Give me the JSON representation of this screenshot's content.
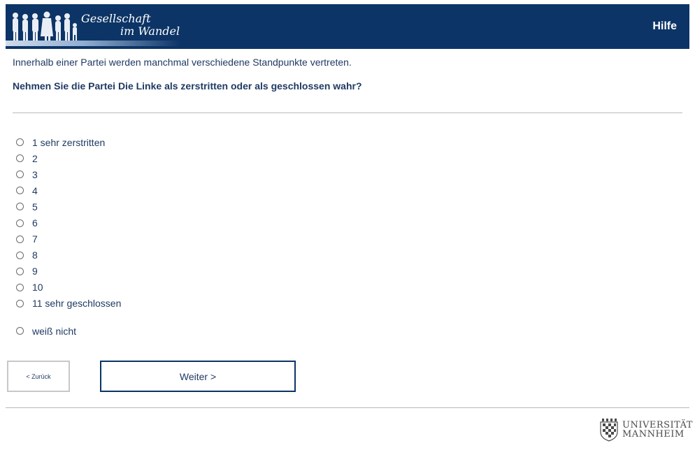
{
  "header": {
    "logo_line1": "Gesellschaft",
    "logo_line2": "im Wandel",
    "help_label": "Hilfe"
  },
  "question": {
    "intro": "Innerhalb einer Partei werden manchmal verschiedene Standpunkte vertreten.",
    "text": "Nehmen Sie die Partei Die Linke als zerstritten oder als geschlossen wahr?"
  },
  "options": [
    "1 sehr zerstritten",
    "2",
    "3",
    "4",
    "5",
    "6",
    "7",
    "8",
    "9",
    "10",
    "11 sehr geschlossen"
  ],
  "dont_know": "weiß nicht",
  "nav": {
    "back_label": "< Zurück",
    "next_label": "Weiter >"
  },
  "footer": {
    "logo_line1": "UNIVERSITÄT",
    "logo_line2": "MANNHEIM"
  }
}
